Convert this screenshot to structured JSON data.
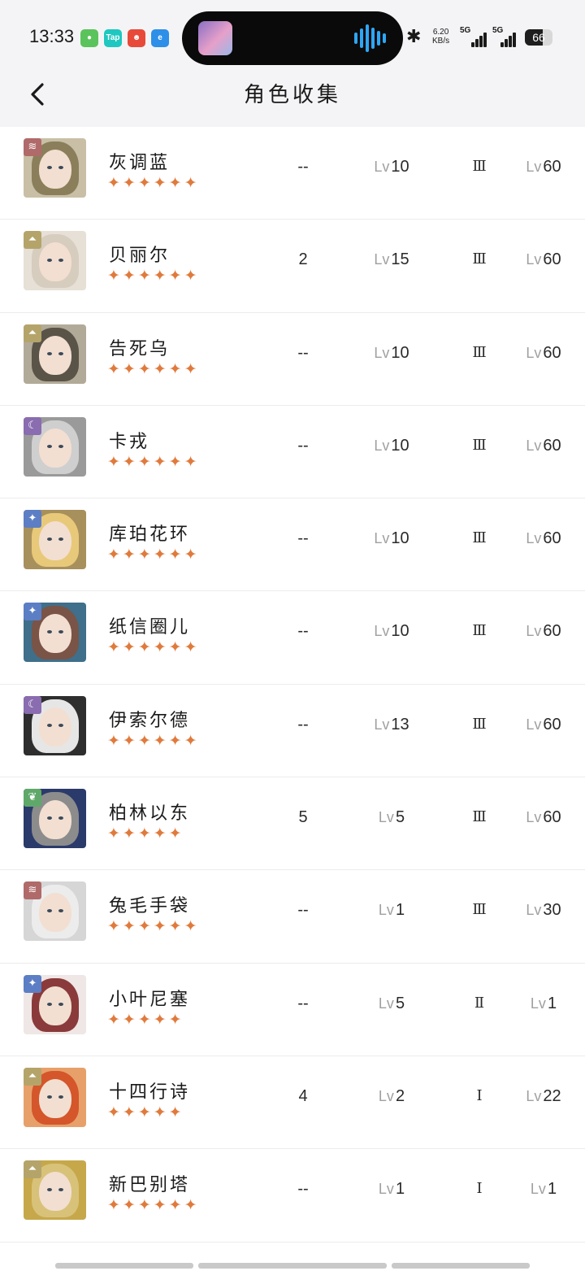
{
  "status": {
    "time": "13:33",
    "apps": [
      {
        "name": "maps-app-icon",
        "color": "#5bc35b",
        "glyph": "●"
      },
      {
        "name": "taptap-app-icon",
        "color": "#1ec8c0",
        "glyph": "Tap"
      },
      {
        "name": "game-app-icon",
        "color": "#e84a3a",
        "glyph": "☻"
      },
      {
        "name": "browser-app-icon",
        "color": "#2d8fe8",
        "glyph": "e"
      }
    ],
    "netspeed_value": "6.20",
    "netspeed_unit": "KB/s",
    "net1": "5G",
    "net2": "5G",
    "battery": "66",
    "battery_level": 0.66
  },
  "header": {
    "title": "角色收集"
  },
  "characters": [
    {
      "name": "灰调蓝",
      "stars": "✦✦✦✦✦✦",
      "count": "--",
      "lv": "10",
      "insight": "Ⅲ",
      "lv2": "60",
      "afflatus": "beast",
      "badge_color": "#b06a6a",
      "hair": "#8a7f5a",
      "bg": "#c8bfa6"
    },
    {
      "name": "贝丽尔",
      "stars": "✦✦✦✦✦✦",
      "count": "2",
      "lv": "15",
      "insight": "Ⅲ",
      "lv2": "60",
      "afflatus": "mineral",
      "badge_color": "#b5a46a",
      "hair": "#d6cdbf",
      "bg": "#e6e0d6"
    },
    {
      "name": "告死乌",
      "stars": "✦✦✦✦✦✦",
      "count": "--",
      "lv": "10",
      "insight": "Ⅲ",
      "lv2": "60",
      "afflatus": "mineral",
      "badge_color": "#b5a46a",
      "hair": "#5a5448",
      "bg": "#b2aa98"
    },
    {
      "name": "卡戎",
      "stars": "✦✦✦✦✦✦",
      "count": "--",
      "lv": "10",
      "insight": "Ⅲ",
      "lv2": "60",
      "afflatus": "spirit",
      "badge_color": "#8a6cb0",
      "hair": "#cfcfcf",
      "bg": "#9a9a9a"
    },
    {
      "name": "库珀花环",
      "stars": "✦✦✦✦✦✦",
      "count": "--",
      "lv": "10",
      "insight": "Ⅲ",
      "lv2": "60",
      "afflatus": "star",
      "badge_color": "#5c7ec4",
      "hair": "#e8c97a",
      "bg": "#a8905c"
    },
    {
      "name": "纸信圈儿",
      "stars": "✦✦✦✦✦✦",
      "count": "--",
      "lv": "10",
      "insight": "Ⅲ",
      "lv2": "60",
      "afflatus": "star",
      "badge_color": "#5c7ec4",
      "hair": "#7a5446",
      "bg": "#3f6f8a"
    },
    {
      "name": "伊索尔德",
      "stars": "✦✦✦✦✦✦",
      "count": "--",
      "lv": "13",
      "insight": "Ⅲ",
      "lv2": "60",
      "afflatus": "spirit",
      "badge_color": "#8a6cb0",
      "hair": "#e6e6e6",
      "bg": "#2e2e2e"
    },
    {
      "name": "柏林以东",
      "stars": "✦✦✦✦✦",
      "count": "5",
      "lv": "5",
      "insight": "Ⅲ",
      "lv2": "60",
      "afflatus": "plant",
      "badge_color": "#5fa86a",
      "hair": "#8c8c8c",
      "bg": "#2a3a6a"
    },
    {
      "name": "兔毛手袋",
      "stars": "✦✦✦✦✦✦",
      "count": "--",
      "lv": "1",
      "insight": "Ⅲ",
      "lv2": "30",
      "afflatus": "beast",
      "badge_color": "#b06a6a",
      "hair": "#ececec",
      "bg": "#d6d6d6"
    },
    {
      "name": "小叶尼塞",
      "stars": "✦✦✦✦✦",
      "count": "--",
      "lv": "5",
      "insight": "Ⅱ",
      "lv2": "1",
      "afflatus": "star",
      "badge_color": "#5c7ec4",
      "hair": "#8a3a3a",
      "bg": "#efe6e6"
    },
    {
      "name": "十四行诗",
      "stars": "✦✦✦✦✦",
      "count": "4",
      "lv": "2",
      "insight": "Ⅰ",
      "lv2": "22",
      "afflatus": "mineral",
      "badge_color": "#b5a46a",
      "hair": "#d4562a",
      "bg": "#e8a06a"
    },
    {
      "name": "新巴别塔",
      "stars": "✦✦✦✦✦✦",
      "count": "--",
      "lv": "1",
      "insight": "Ⅰ",
      "lv2": "1",
      "afflatus": "mineral",
      "badge_color": "#b5a46a",
      "hair": "#d8c27a",
      "bg": "#c6a84a"
    }
  ],
  "labels": {
    "lv_prefix": "Lv"
  }
}
